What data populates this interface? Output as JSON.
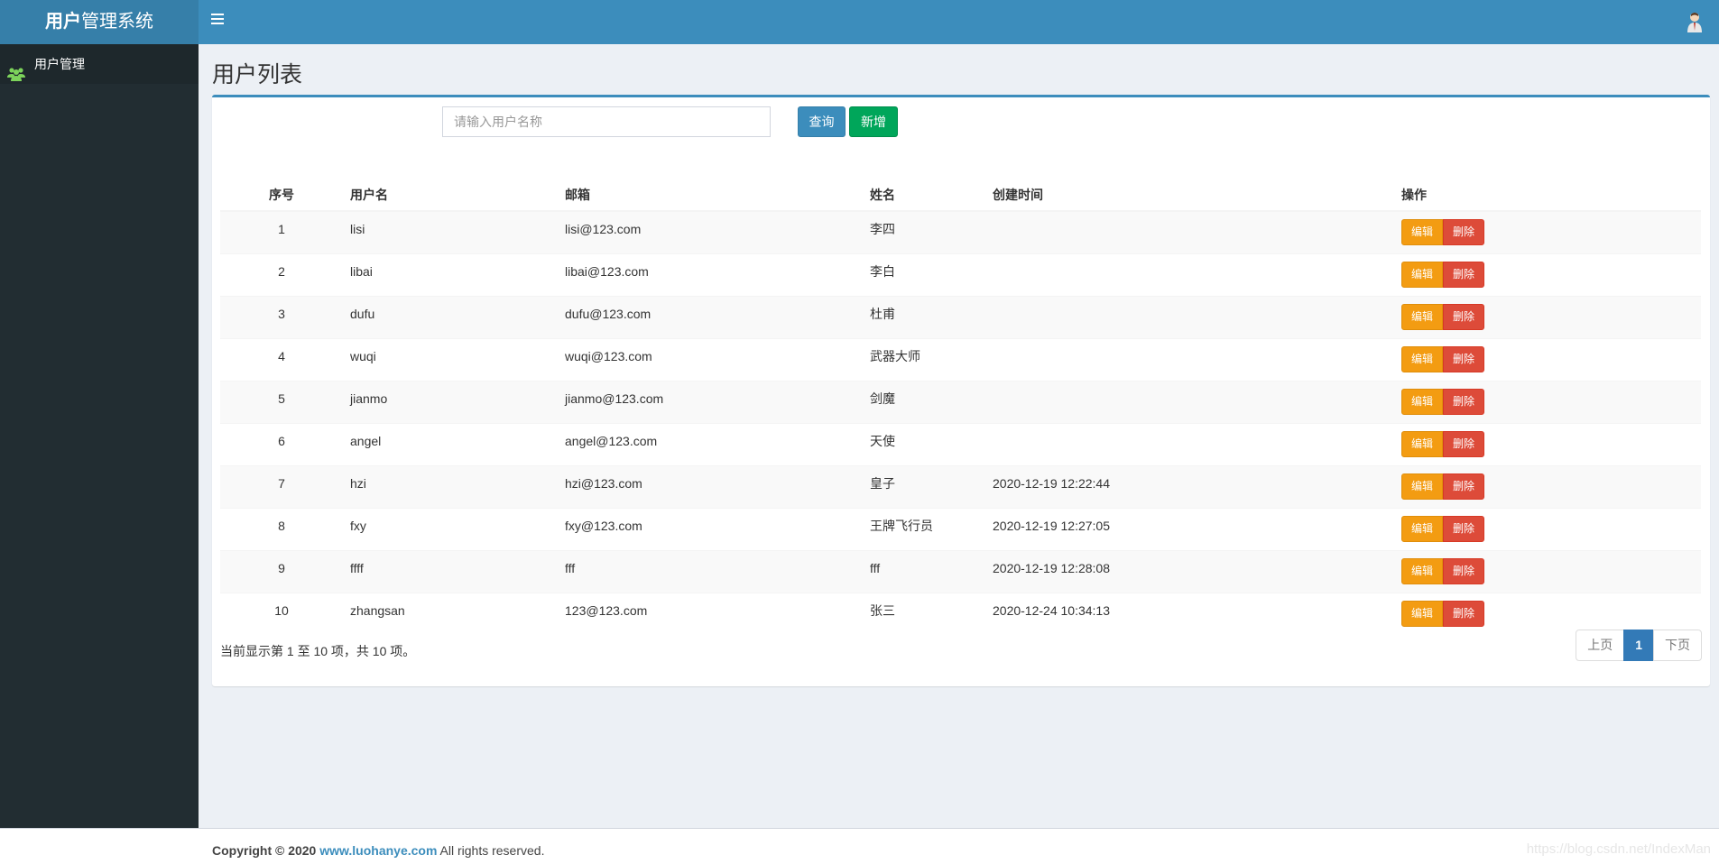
{
  "header": {
    "logo_bold": "用户",
    "logo_rest": "管理系统"
  },
  "sidebar": {
    "items": [
      {
        "label": "用户管理",
        "icon": "users-icon"
      }
    ]
  },
  "page": {
    "title": "用户列表"
  },
  "search": {
    "placeholder": "请输入用户名称",
    "query_label": "查询",
    "add_label": "新增"
  },
  "table": {
    "columns": [
      "序号",
      "用户名",
      "邮箱",
      "姓名",
      "创建时间",
      "操作"
    ],
    "edit_label": "编辑",
    "delete_label": "删除",
    "rows": [
      {
        "idx": "1",
        "username": "lisi",
        "email": "lisi@123.com",
        "name": "李四",
        "created": ""
      },
      {
        "idx": "2",
        "username": "libai",
        "email": "libai@123.com",
        "name": "李白",
        "created": ""
      },
      {
        "idx": "3",
        "username": "dufu",
        "email": "dufu@123.com",
        "name": "杜甫",
        "created": ""
      },
      {
        "idx": "4",
        "username": "wuqi",
        "email": "wuqi@123.com",
        "name": "武器大师",
        "created": ""
      },
      {
        "idx": "5",
        "username": "jianmo",
        "email": "jianmo@123.com",
        "name": "剑魔",
        "created": ""
      },
      {
        "idx": "6",
        "username": "angel",
        "email": "angel@123.com",
        "name": "天使",
        "created": ""
      },
      {
        "idx": "7",
        "username": "hzi",
        "email": "hzi@123.com",
        "name": "皇子",
        "created": "2020-12-19 12:22:44"
      },
      {
        "idx": "8",
        "username": "fxy",
        "email": "fxy@123.com",
        "name": "王牌飞行员",
        "created": "2020-12-19 12:27:05"
      },
      {
        "idx": "9",
        "username": "ffff",
        "email": "fff",
        "name": "fff",
        "created": "2020-12-19 12:28:08"
      },
      {
        "idx": "10",
        "username": "zhangsan",
        "email": "123@123.com",
        "name": "张三",
        "created": "2020-12-24 10:34:13"
      }
    ]
  },
  "pagination": {
    "info": "当前显示第 1 至 10 项，共 10 项。",
    "prev": "上页",
    "current": "1",
    "next": "下页"
  },
  "footer": {
    "copyright": "Copyright © 2020",
    "link": "www.luohanye.com",
    "rights": "All rights reserved.",
    "watermark": "https://blog.csdn.net/IndexMan"
  },
  "colors": {
    "header": "#3c8dbc",
    "logo_bg": "#367fa9",
    "sidebar": "#222d32",
    "query_button": "#3c8dbc",
    "add_button": "#00a65a",
    "edit_button": "#f39c12",
    "delete_button": "#dd4b39"
  }
}
